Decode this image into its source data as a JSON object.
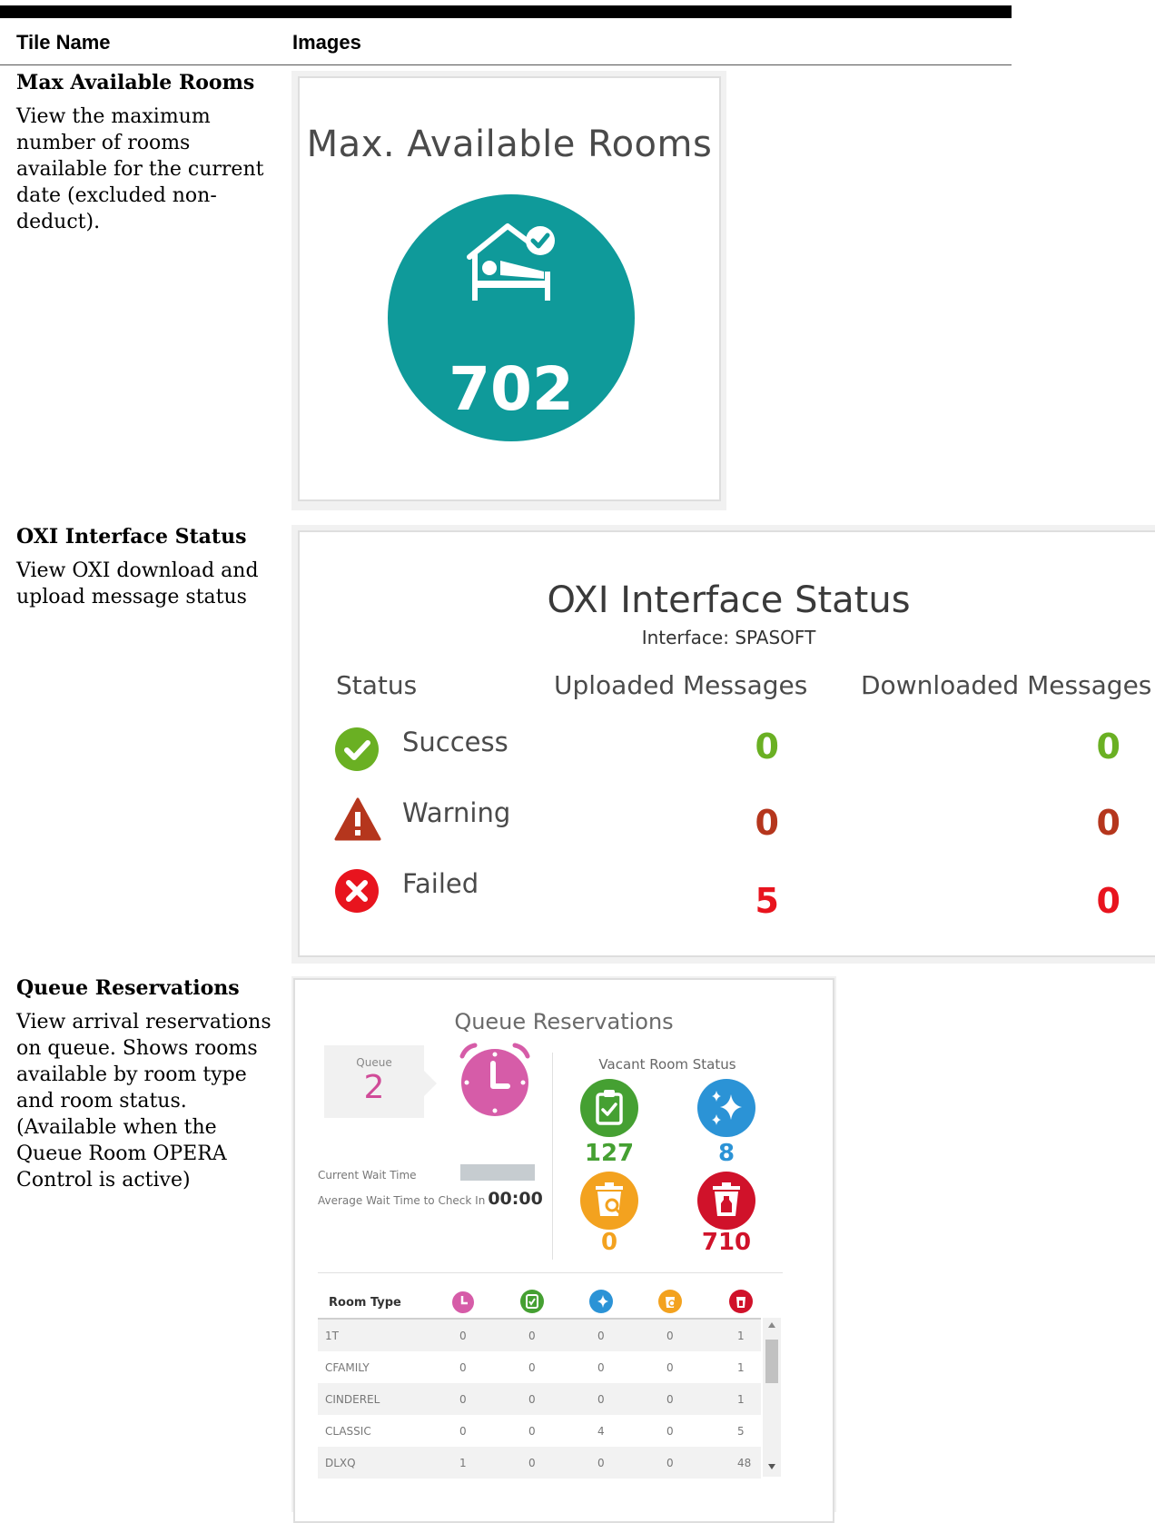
{
  "table_header": {
    "tile_name": "Tile Name",
    "images": "Images"
  },
  "rows": [
    {
      "name": "Max Available Rooms",
      "description": "View the maximum number of rooms available for the current date (excluded non-deduct).",
      "tile": {
        "title": "Max. Available Rooms",
        "value": "702",
        "icon": "bed-check-icon",
        "circle_color": "#0f9a9a"
      }
    },
    {
      "name": "OXI Interface Status",
      "description": "View OXI download and upload message status",
      "tile": {
        "title": "OXI Interface Status",
        "interface": "Interface: SPASOFT",
        "columns": [
          "Status",
          "Uploaded Messages",
          "Downloaded Messages"
        ],
        "statuses": [
          {
            "label": "Success",
            "icon": "check-circle-icon",
            "uploaded": "0",
            "downloaded": "0",
            "color": "#6ab023"
          },
          {
            "label": "Warning",
            "icon": "warning-triangle-icon",
            "uploaded": "0",
            "downloaded": "0",
            "color": "#b5361d"
          },
          {
            "label": "Failed",
            "icon": "x-circle-icon",
            "uploaded": "5",
            "downloaded": "0",
            "color": "#e8141e"
          }
        ]
      }
    },
    {
      "name": "Queue Reservations",
      "description": "View arrival reservations on queue. Shows rooms available by room type and room status. (Available when the Queue Room OPERA Control is active)",
      "tile": {
        "title": "Queue Reservations",
        "queue_label": "Queue",
        "queue_count": "2",
        "current_wait_label": "Current Wait Time",
        "average_wait_label": "Average Wait Time to Check In",
        "average_wait_value": "00:00",
        "vacant_title": "Vacant Room Status",
        "vacant": [
          {
            "icon": "clipboard-check-icon",
            "value": "127",
            "color": "#45a032"
          },
          {
            "icon": "sparkle-icon",
            "value": "8",
            "color": "#2b93d6"
          },
          {
            "icon": "trash-search-icon",
            "value": "0",
            "color": "#f3a21f"
          },
          {
            "icon": "trash-bottle-icon",
            "value": "710",
            "color": "#d0122a"
          }
        ],
        "table": {
          "header": "Room Type",
          "header_icons": [
            {
              "icon": "clock-icon",
              "color": "#d65ca8"
            },
            {
              "icon": "clipboard-check-icon",
              "color": "#45a032"
            },
            {
              "icon": "sparkle-icon",
              "color": "#2b93d6"
            },
            {
              "icon": "trash-search-icon",
              "color": "#f3a21f"
            },
            {
              "icon": "trash-bottle-icon",
              "color": "#d0122a"
            }
          ],
          "rows": [
            {
              "type": "1T",
              "values": [
                "0",
                "0",
                "0",
                "0",
                "1"
              ]
            },
            {
              "type": "CFAMILY",
              "values": [
                "0",
                "0",
                "0",
                "0",
                "1"
              ]
            },
            {
              "type": "CINDEREL",
              "values": [
                "0",
                "0",
                "0",
                "0",
                "1"
              ]
            },
            {
              "type": "CLASSIC",
              "values": [
                "0",
                "0",
                "4",
                "0",
                "5"
              ]
            },
            {
              "type": "DLXQ",
              "values": [
                "1",
                "0",
                "0",
                "0",
                "48"
              ]
            }
          ]
        }
      }
    }
  ]
}
